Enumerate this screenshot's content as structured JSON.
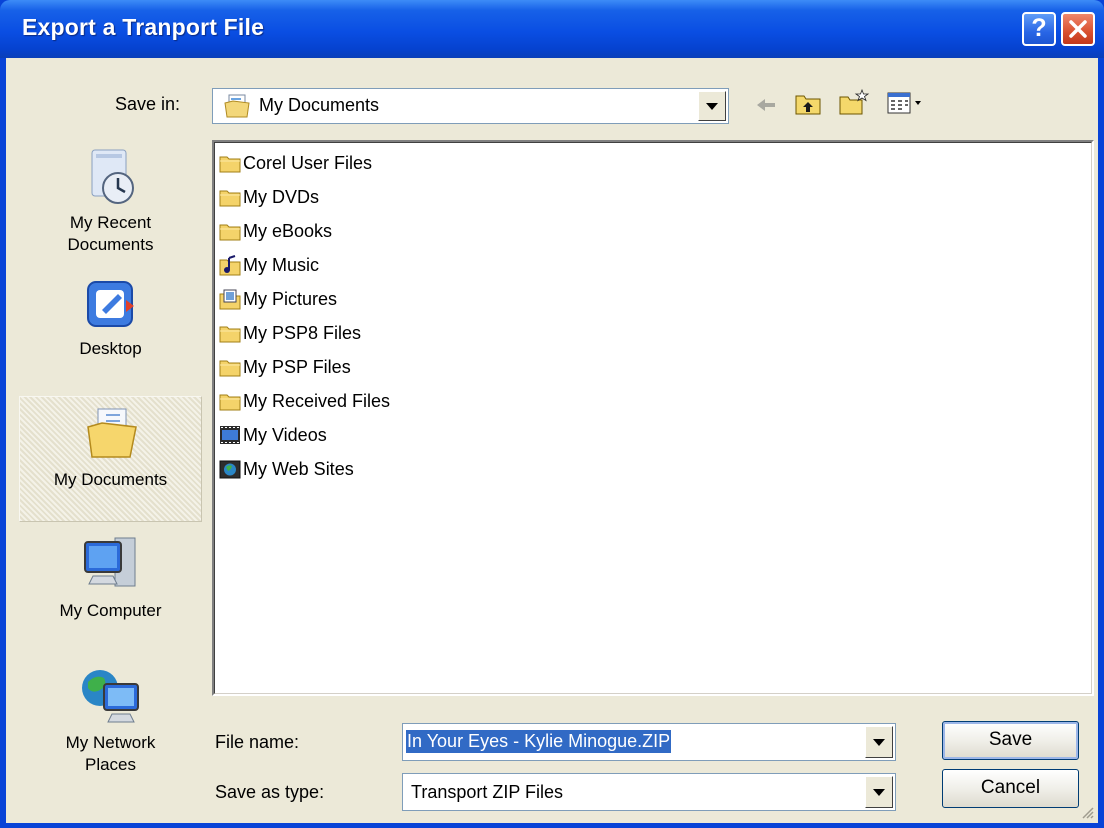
{
  "window": {
    "title": "Export a Tranport File"
  },
  "titlebar": {
    "help_label": "?",
    "close_label": "✕"
  },
  "save_in": {
    "label": "Save in:",
    "value": "My Documents"
  },
  "places": [
    {
      "label": "My Recent Documents",
      "icon": "recent-documents-icon"
    },
    {
      "label": "Desktop",
      "icon": "desktop-icon"
    },
    {
      "label": "My Documents",
      "icon": "my-documents-icon",
      "selected": true
    },
    {
      "label": "My Computer",
      "icon": "my-computer-icon"
    },
    {
      "label": "My Network Places",
      "icon": "network-places-icon"
    }
  ],
  "files": [
    {
      "name": "Corel User Files",
      "icon": "folder-icon"
    },
    {
      "name": "My DVDs",
      "icon": "folder-icon"
    },
    {
      "name": "My eBooks",
      "icon": "folder-icon"
    },
    {
      "name": "My Music",
      "icon": "music-folder-icon"
    },
    {
      "name": "My Pictures",
      "icon": "pictures-folder-icon"
    },
    {
      "name": "My PSP8 Files",
      "icon": "folder-icon"
    },
    {
      "name": "My PSP Files",
      "icon": "folder-icon"
    },
    {
      "name": "My Received Files",
      "icon": "folder-icon"
    },
    {
      "name": "My Videos",
      "icon": "videos-folder-icon"
    },
    {
      "name": "My Web Sites",
      "icon": "web-sites-folder-icon"
    }
  ],
  "file_name": {
    "label": "File name:",
    "value": "In Your Eyes - Kylie Minogue.ZIP"
  },
  "save_as_type": {
    "label": "Save as type:",
    "value": "Transport ZIP Files"
  },
  "buttons": {
    "save": "Save",
    "cancel": "Cancel"
  },
  "colors": {
    "title_blue": "#0a4ee3",
    "selection": "#316ac5",
    "dialog_bg": "#ece9d8"
  }
}
